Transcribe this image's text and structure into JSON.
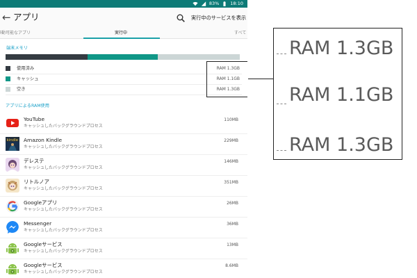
{
  "status_bar": {
    "battery": "83%",
    "time": "18:10"
  },
  "header": {
    "title": "アプリ",
    "show_running_label": "実行中のサービスを表示"
  },
  "tabs": [
    {
      "label": "移動可能なアプリ"
    },
    {
      "label": "実行中"
    },
    {
      "label": "すべて"
    }
  ],
  "device_memory": {
    "section_title": "端末メモリ",
    "used_fraction": 0.35,
    "cache_fraction": 0.3,
    "free_fraction": 0.35,
    "legend": [
      {
        "label": "使用済み",
        "value": "RAM 1.3GB",
        "color": "#343b42"
      },
      {
        "label": "キャッシュ",
        "value": "RAM 1.1GB",
        "color": "#109787"
      },
      {
        "label": "空き",
        "value": "RAM 1.3GB",
        "color": "#ccd6d6"
      }
    ]
  },
  "apps_section_title": "アプリによるRAM使用",
  "apps": [
    {
      "name": "YouTube",
      "sub": "キャッシュしたバックグラウンドプロセス",
      "size": "110MB",
      "icon": "youtube-icon"
    },
    {
      "name": "Amazon Kindle",
      "sub": "キャッシュしたバックグラウンドプロセス",
      "size": "229MB",
      "icon": "kindle-icon"
    },
    {
      "name": "デレステ",
      "sub": "キャッシュしたバックグラウンドプロセス",
      "size": "146MB",
      "icon": "dereste-icon"
    },
    {
      "name": "リトルノア",
      "sub": "キャッシュしたバックグラウンドプロセス",
      "size": "351MB",
      "icon": "little-noah-icon"
    },
    {
      "name": "Googleアプリ",
      "sub": "キャッシュしたバックグラウンドプロセス",
      "size": "26MB",
      "icon": "google-icon"
    },
    {
      "name": "Messenger",
      "sub": "キャッシュしたバックグラウンドプロセス",
      "size": "36MB",
      "icon": "messenger-icon"
    },
    {
      "name": "Googleサービス",
      "sub": "キャッシュしたバックグラウンドプロセス",
      "size": "13MB",
      "icon": "android-icon"
    },
    {
      "name": "Googleサービス",
      "sub": "キャッシュしたバックグラウンドプロセス",
      "size": "8.6MB",
      "icon": "android-icon"
    }
  ],
  "zoom": {
    "values": [
      "RAM 1.3GB",
      "RAM 1.1GB",
      "RAM 1.3GB"
    ]
  }
}
